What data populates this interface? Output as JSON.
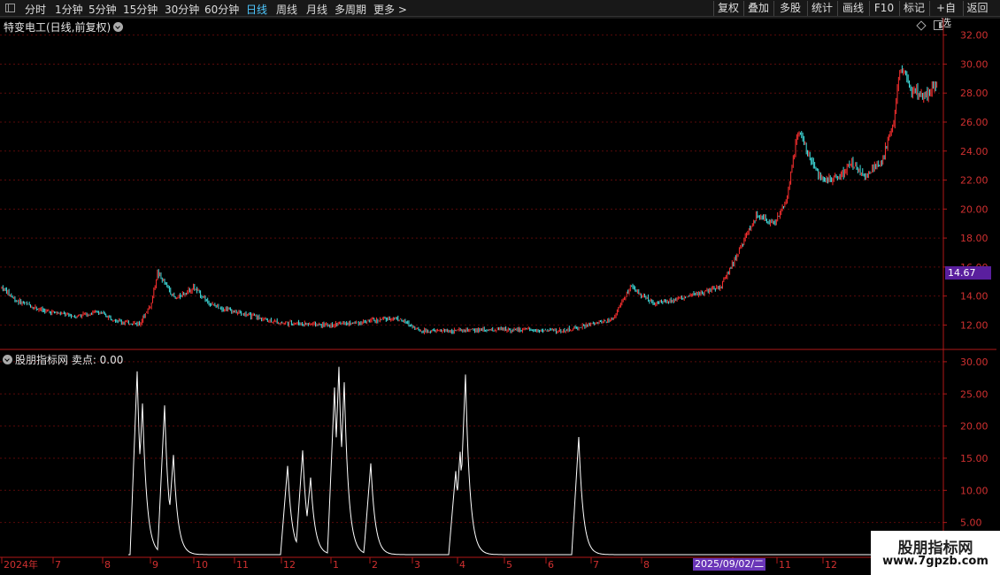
{
  "toolbar": {
    "timeframes": [
      "分时",
      "1分钟",
      "5分钟",
      "15分钟",
      "30分钟",
      "60分钟",
      "日线",
      "周线",
      "月线",
      "多周期",
      "更多 >"
    ],
    "active": "日线",
    "right_buttons": [
      "复权",
      "叠加",
      "多股",
      "统计",
      "画线",
      "F10",
      "标记",
      "+自选",
      "返回"
    ]
  },
  "main": {
    "title": "特变电工(日线,前复权)",
    "current_price": "14.67"
  },
  "indicator": {
    "title": "股朋指标网  卖点: 0.00"
  },
  "x_axis": {
    "cursor_date": "2025/09/02/二"
  },
  "watermark": {
    "title": "股朋指标网",
    "url": "www.7gpzb.com"
  },
  "colors": {
    "up": "#ff3030",
    "down": "#40e0e0",
    "grid": "#5a0a0a",
    "axis": "#b01818",
    "accent": "#5a1f9e",
    "indicator_line": "#ffffff"
  },
  "chart_data": [
    {
      "type": "candlestick",
      "title": "特变电工(日线,前复权)",
      "y_ticks": [
        "32.00",
        "30.00",
        "28.00",
        "26.00",
        "24.00",
        "22.00",
        "20.00",
        "18.00",
        "16.00",
        "14.00",
        "12.00"
      ],
      "ylim": [
        10.5,
        33.2
      ],
      "grid": true,
      "month_labels": [
        "2024年",
        "7",
        "8",
        "9",
        "10",
        "11",
        "12",
        "1",
        "2",
        "3",
        "4",
        "5",
        "6",
        "7",
        "8",
        "9",
        "10",
        "11",
        "12"
      ],
      "close_keypoints": [
        [
          0,
          14.6
        ],
        [
          12,
          13.7
        ],
        [
          35,
          13.0
        ],
        [
          60,
          12.6
        ],
        [
          80,
          12.9
        ],
        [
          100,
          12.2
        ],
        [
          115,
          12.1
        ],
        [
          125,
          13.5
        ],
        [
          130,
          15.6
        ],
        [
          145,
          13.8
        ],
        [
          160,
          14.6
        ],
        [
          175,
          13.4
        ],
        [
          200,
          12.8
        ],
        [
          230,
          12.2
        ],
        [
          270,
          12.0
        ],
        [
          300,
          12.2
        ],
        [
          330,
          12.5
        ],
        [
          350,
          11.6
        ],
        [
          380,
          11.6
        ],
        [
          420,
          11.7
        ],
        [
          470,
          11.6
        ],
        [
          490,
          12.0
        ],
        [
          510,
          12.4
        ],
        [
          525,
          14.6
        ],
        [
          545,
          13.5
        ],
        [
          570,
          13.9
        ],
        [
          600,
          14.6
        ],
        [
          612,
          16.5
        ],
        [
          630,
          19.5
        ],
        [
          645,
          19.0
        ],
        [
          655,
          20.5
        ],
        [
          665,
          25.5
        ],
        [
          675,
          23.5
        ],
        [
          685,
          22.0
        ],
        [
          700,
          22.2
        ],
        [
          710,
          23.2
        ],
        [
          720,
          22.3
        ],
        [
          735,
          23.3
        ],
        [
          745,
          26.0
        ],
        [
          750,
          29.5
        ],
        [
          755,
          29.3
        ],
        [
          760,
          28.2
        ],
        [
          770,
          27.8
        ],
        [
          780,
          28.6
        ]
      ]
    },
    {
      "type": "line",
      "series": [
        {
          "name": "卖点",
          "values": "spikes"
        }
      ],
      "y_ticks": [
        "30.00",
        "25.00",
        "20.00",
        "15.00",
        "10.00",
        "5.00"
      ],
      "ylim": [
        0,
        31.5
      ],
      "spikes": [
        [
          155,
          28.5
        ],
        [
          161,
          23.5
        ],
        [
          186,
          23.2
        ],
        [
          196,
          15.5
        ],
        [
          325,
          13.8
        ],
        [
          342,
          16.2
        ],
        [
          351,
          12.0
        ],
        [
          378,
          26.0
        ],
        [
          383,
          29.2
        ],
        [
          389,
          26.8
        ],
        [
          419,
          14.2
        ],
        [
          515,
          13.0
        ],
        [
          520,
          16.0
        ],
        [
          526,
          28.0
        ],
        [
          654,
          18.3
        ]
      ],
      "baseline": 0
    }
  ]
}
